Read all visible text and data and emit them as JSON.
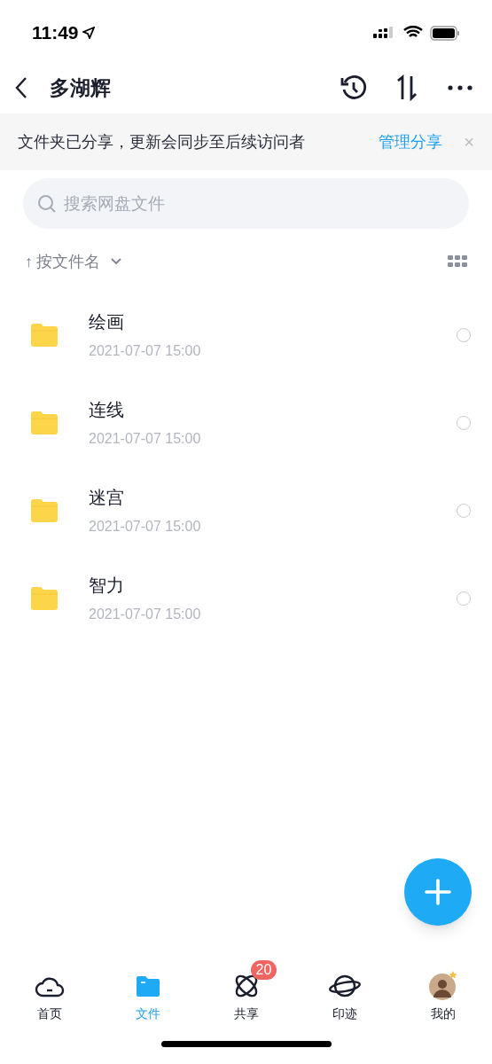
{
  "status_bar": {
    "time": "11:49"
  },
  "header": {
    "title": "多湖辉"
  },
  "banner": {
    "text": "文件夹已分享，更新会同步至后续访问者",
    "action": "管理分享",
    "close": "×"
  },
  "search": {
    "placeholder": "搜索网盘文件"
  },
  "sort": {
    "arrow": "↑",
    "label": "按文件名"
  },
  "files": [
    {
      "name": "绘画",
      "date": "2021-07-07 15:00",
      "selected": false
    },
    {
      "name": "连线",
      "date": "2021-07-07 15:00",
      "selected": false
    },
    {
      "name": "迷宫",
      "date": "2021-07-07 15:00",
      "selected": false
    },
    {
      "name": "智力",
      "date": "2021-07-07 15:00",
      "selected": false
    }
  ],
  "tabs": [
    {
      "kind": "cloud",
      "label": "首页",
      "selected": false
    },
    {
      "kind": "folder",
      "label": "文件",
      "selected": true
    },
    {
      "kind": "orbit",
      "label": "共享",
      "selected": false,
      "badge": "20"
    },
    {
      "kind": "planet",
      "label": "印迹",
      "selected": false
    },
    {
      "kind": "avatar",
      "label": "我的",
      "selected": false
    }
  ]
}
